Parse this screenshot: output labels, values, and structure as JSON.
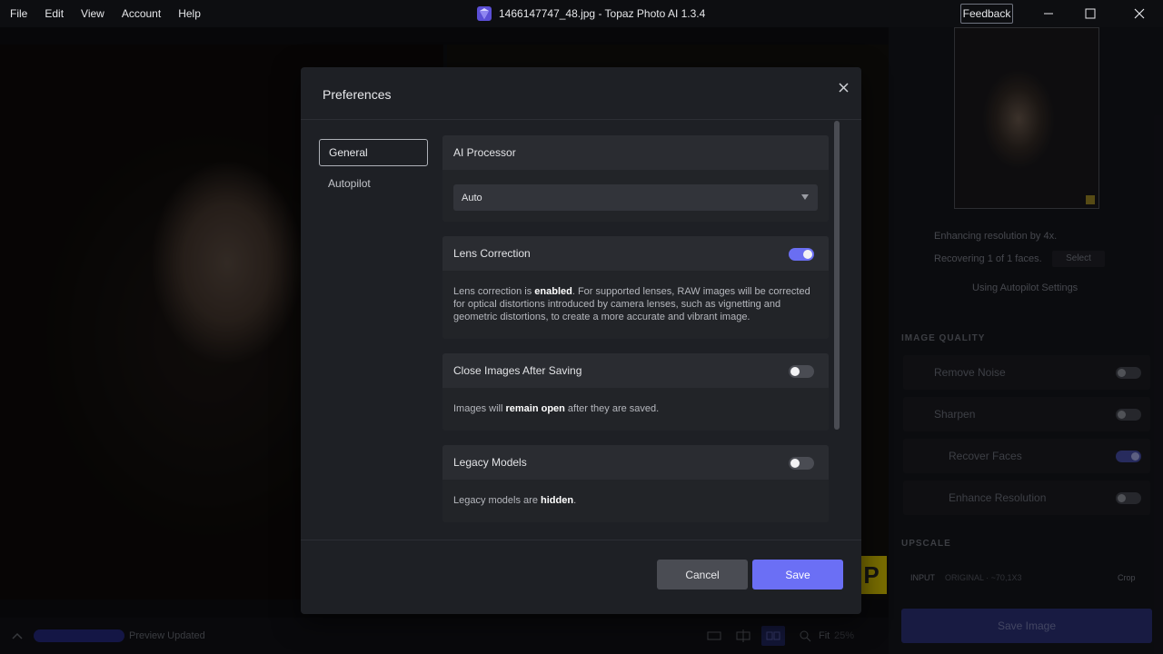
{
  "titlebar": {
    "menu": [
      "File",
      "Edit",
      "View",
      "Account",
      "Help"
    ],
    "title": "1466147747_48.jpg - Topaz Photo AI 1.3.4",
    "feedback": "Feedback"
  },
  "right_panel": {
    "enhancing": "Enhancing resolution by 4x.",
    "recovering": "Recovering 1 of 1 faces.",
    "select": "Select",
    "autopilot": "Using Autopilot Settings",
    "image_quality_heading": "IMAGE QUALITY",
    "remove_noise": "Remove Noise",
    "sharpen": "Sharpen",
    "recover_faces": "Recover Faces",
    "enhance_resolution": "Enhance Resolution",
    "upscale_heading": "UPSCALE",
    "input_label": "INPUT",
    "input_value": "ORIGINAL · ~70,1X3",
    "crop": "Crop",
    "save_image": "Save Image"
  },
  "bottombar": {
    "status": "Preview Updated",
    "fit": "Fit",
    "zoom": "25%"
  },
  "canvas": {
    "yellow_letter": "P"
  },
  "modal": {
    "title": "Preferences",
    "nav": [
      "General",
      "Autopilot"
    ],
    "ai_processor": {
      "title": "AI Processor",
      "value": "Auto"
    },
    "lens_correction": {
      "title": "Lens Correction",
      "enabled": true,
      "desc_pre": "Lens correction is ",
      "desc_bold": "enabled",
      "desc_post": ". For supported lenses, RAW images will be corrected for optical distortions introduced by camera lenses, such as vignetting and geometric distortions, to create a more accurate and vibrant image."
    },
    "close_images": {
      "title": "Close Images After Saving",
      "enabled": false,
      "desc_pre": "Images will ",
      "desc_bold": "remain open",
      "desc_post": " after they are saved."
    },
    "legacy_models": {
      "title": "Legacy Models",
      "enabled": false,
      "desc_pre": "Legacy models are ",
      "desc_bold": "hidden",
      "desc_post": "."
    },
    "cancel": "Cancel",
    "save": "Save"
  },
  "colors": {
    "accent": "#6b6ff5",
    "modal_bg": "#1e2025"
  }
}
